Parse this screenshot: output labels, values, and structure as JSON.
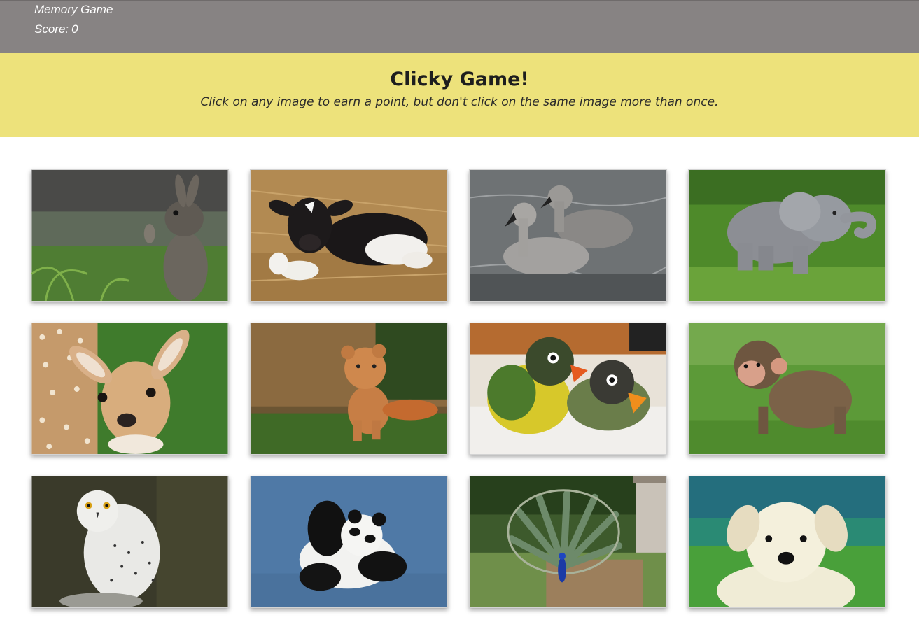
{
  "nav": {
    "brand": "Memory Game",
    "score_label": "Score:",
    "score_value": "0"
  },
  "hero": {
    "title": "Clicky Game!",
    "subtitle": "Click on any image to earn a point, but don't click on the same image more than once."
  },
  "cards": [
    {
      "animal": "rabbit"
    },
    {
      "animal": "calf"
    },
    {
      "animal": "cygnets"
    },
    {
      "animal": "elephant"
    },
    {
      "animal": "fawn"
    },
    {
      "animal": "lion-cub"
    },
    {
      "animal": "lovebirds"
    },
    {
      "animal": "monkey"
    },
    {
      "animal": "snowy-owl"
    },
    {
      "animal": "panda"
    },
    {
      "animal": "peacock"
    },
    {
      "animal": "puppy"
    }
  ],
  "colors": {
    "navbar": "#878383",
    "hero": "#ede27b",
    "text_dark": "#1e1e1e"
  }
}
